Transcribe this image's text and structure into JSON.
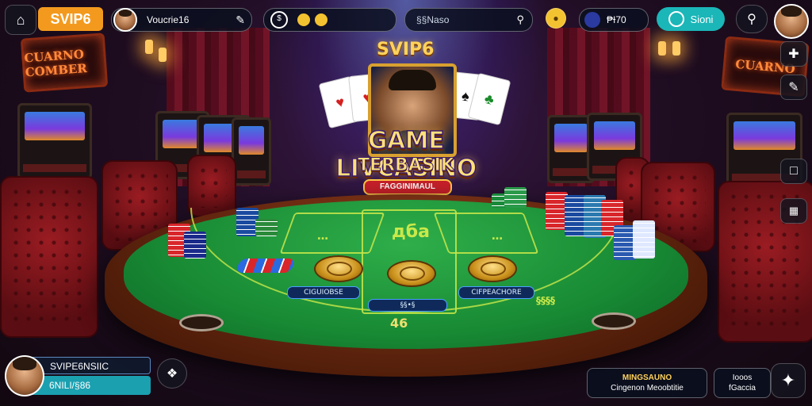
{
  "top_bar": {
    "brand_badge": "SVIP6",
    "player_name": "Voucrie16",
    "coin_pill_left_value": "",
    "search_placeholder": "§§Naso",
    "token_count": "₱Ɨ70",
    "connect_button_label": "Sioni",
    "brand_color": "#f39a1e",
    "accent_teal": "#1bb6b8"
  },
  "side_tools": {
    "items": [
      "plus-icon",
      "pencil-icon",
      "bookmark-icon",
      "stats-icon"
    ]
  },
  "banner": {
    "vip_title": "SVIP6",
    "game_title": "GAME LIVCASINO",
    "subtitle": "TERBASIK",
    "ribbon_text": "FAGGINIMAUL",
    "cards": [
      "♥",
      "♠",
      "♣"
    ]
  },
  "signs": {
    "left_neon": "CUARNO COMBER",
    "right_neon": "CUARNO"
  },
  "table": {
    "bet_spots": [
      "…",
      "дба",
      "…"
    ],
    "left_label": "CIGUIOBSE",
    "center_label": "§§•§",
    "right_label": "CIFPEACHORE",
    "right_side_text": "§§§§",
    "table_number": "46",
    "felt_color": "#1d9a3c"
  },
  "player_card": {
    "name": "SVIPE6NSIIC",
    "balance": "6NILI/§86"
  },
  "bottom_right": {
    "promo_title": "MINGSAUNO",
    "promo_subtitle": "Cingenon Meoobtitie",
    "box_line1": "Iooos",
    "box_line2": "fGaccia"
  }
}
